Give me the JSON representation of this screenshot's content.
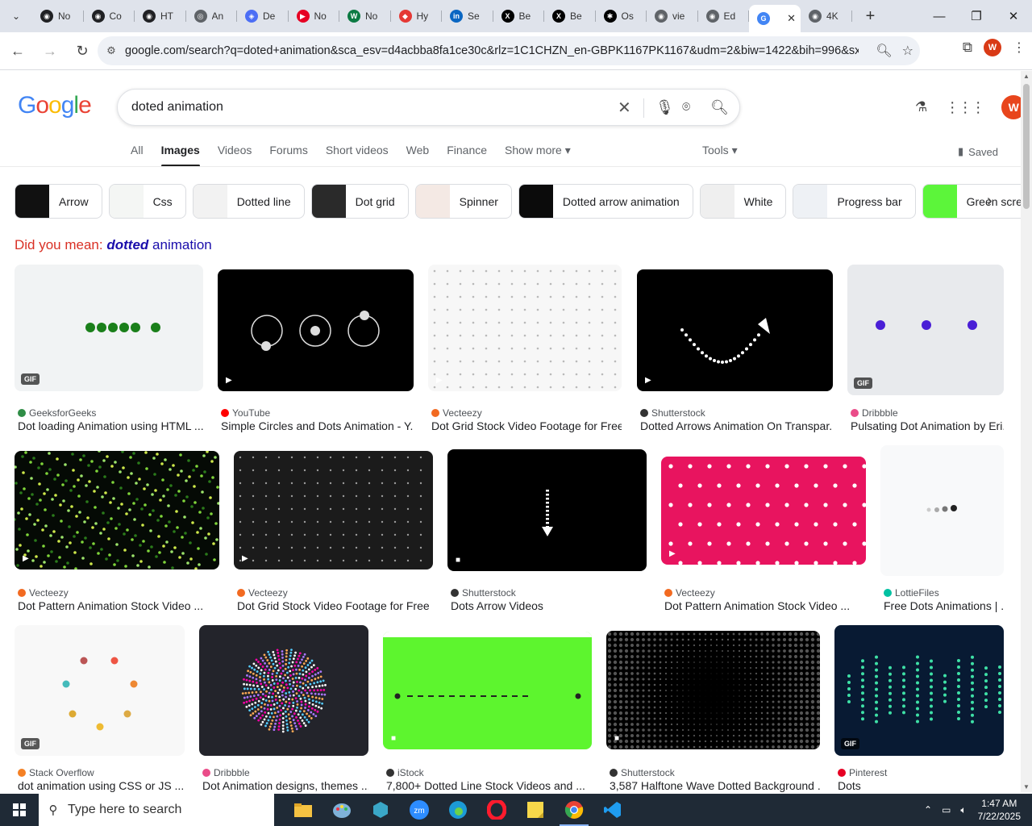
{
  "browser": {
    "tabs": [
      {
        "title": "No",
        "fav_color": "#202124",
        "fav_glyph": "◉"
      },
      {
        "title": "Co",
        "fav_color": "#202124",
        "fav_glyph": "◉"
      },
      {
        "title": "HT",
        "fav_color": "#202124",
        "fav_glyph": "◉"
      },
      {
        "title": "An",
        "fav_color": "#5f6368",
        "fav_glyph": "◎"
      },
      {
        "title": "De",
        "fav_color": "#4c6ef5",
        "fav_glyph": "◈"
      },
      {
        "title": "No",
        "fav_color": "#e60023",
        "fav_glyph": "▶"
      },
      {
        "title": "No",
        "fav_color": "#0c7a43",
        "fav_glyph": "W"
      },
      {
        "title": "Hy",
        "fav_color": "#e53935",
        "fav_glyph": "◆"
      },
      {
        "title": "Se",
        "fav_color": "#0a66c2",
        "fav_glyph": "in"
      },
      {
        "title": "Be",
        "fav_color": "#000000",
        "fav_glyph": "X"
      },
      {
        "title": "Be",
        "fav_color": "#000000",
        "fav_glyph": "X"
      },
      {
        "title": "Os",
        "fav_color": "#000000",
        "fav_glyph": "✱"
      },
      {
        "title": "vie",
        "fav_color": "#5f6368",
        "fav_glyph": "◉"
      },
      {
        "title": "Ed",
        "fav_color": "#5f6368",
        "fav_glyph": "◉"
      },
      {
        "title": "",
        "fav_color": "#4285f4",
        "fav_glyph": "G",
        "active": true
      },
      {
        "title": "4K",
        "fav_color": "#5f6368",
        "fav_glyph": "◉"
      }
    ],
    "url": "google.com/search?q=doted+animation&sca_esv=d4acbba8fa1ce30c&rlz=1C1CHZN_en-GBPK1167PK1167&udm=2&biw=1422&bih=996&sxsrf...",
    "profile_initial": "W"
  },
  "search": {
    "query": "doted animation",
    "logo": [
      "G",
      "o",
      "o",
      "g",
      "l",
      "e"
    ],
    "logo_colors": [
      "#4285f4",
      "#ea4335",
      "#fbbc05",
      "#4285f4",
      "#34a853",
      "#ea4335"
    ],
    "avatar_initial": "W"
  },
  "navtabs": [
    "All",
    "Images",
    "Videos",
    "Forums",
    "Short videos",
    "Web",
    "Finance",
    "Show more ▾"
  ],
  "active_tab": "Images",
  "tools_label": "Tools ▾",
  "saved_label": "Saved",
  "chips": [
    {
      "label": "Arrow",
      "thumb": "#111111"
    },
    {
      "label": "Css",
      "thumb": "#f4f6f4"
    },
    {
      "label": "Dotted line",
      "thumb": "#f2f2f2"
    },
    {
      "label": "Dot grid",
      "thumb": "#2a2a2a"
    },
    {
      "label": "Spinner",
      "thumb": "#f4e9e4"
    },
    {
      "label": "Dotted arrow animation",
      "thumb": "#0b0b0b"
    },
    {
      "label": "White",
      "thumb": "#efefef"
    },
    {
      "label": "Progress bar",
      "thumb": "#eef1f5"
    },
    {
      "label": "Green screen",
      "thumb": "#5cf53a"
    }
  ],
  "did_you_mean": {
    "prefix": "Did you mean:",
    "bold": "dotted",
    "rest": "animation"
  },
  "results": [
    {
      "source": "GeeksforGeeks",
      "title": "Dot loading Animation using HTML ...",
      "src_color": "#2f8d46",
      "badge": "GIF"
    },
    {
      "source": "YouTube",
      "title": "Simple Circles and Dots Animation - Y...",
      "src_color": "#ff0000",
      "badge": "▶"
    },
    {
      "source": "Vecteezy",
      "title": "Dot Grid Stock Video Footage for Free...",
      "src_color": "#f26a21",
      "badge": "▶"
    },
    {
      "source": "Shutterstock",
      "title": "Dotted Arrows Animation On Transpar...",
      "src_color": "#333333",
      "badge": "▶"
    },
    {
      "source": "Dribbble",
      "title": "Pulsating Dot Animation by Eri...",
      "src_color": "#ea4c89",
      "badge": "GIF"
    },
    {
      "source": "Vecteezy",
      "title": "Dot Pattern Animation Stock Video ...",
      "src_color": "#f26a21",
      "badge": "▶"
    },
    {
      "source": "Vecteezy",
      "title": "Dot Grid Stock Video Footage for Free ...",
      "src_color": "#f26a21",
      "badge": "▶"
    },
    {
      "source": "Shutterstock",
      "title": "Dots Arrow Videos",
      "src_color": "#333333",
      "badge": "■"
    },
    {
      "source": "Vecteezy",
      "title": "Dot Pattern Animation Stock Video ...",
      "src_color": "#f26a21",
      "badge": "▶"
    },
    {
      "source": "LottieFiles",
      "title": "Free Dots Animations | ...",
      "src_color": "#00c1a2",
      "badge": ""
    },
    {
      "source": "Stack Overflow",
      "title": "dot animation using CSS or JS ...",
      "src_color": "#f48024",
      "badge": "GIF"
    },
    {
      "source": "Dribbble",
      "title": "Dot Animation designs, themes ...",
      "src_color": "#ea4c89",
      "badge": ""
    },
    {
      "source": "iStock",
      "title": "7,800+ Dotted Line Stock Videos and ...",
      "src_color": "#333333",
      "badge": "■"
    },
    {
      "source": "Shutterstock",
      "title": "3,587 Halftone Wave Dotted Background ...",
      "src_color": "#333333",
      "badge": "■"
    },
    {
      "source": "Pinterest",
      "title": "Dots",
      "src_color": "#e60023",
      "badge": "GIF"
    }
  ],
  "taskbar": {
    "search_placeholder": "Type here to search",
    "time": "1:47 AM",
    "date": "7/22/2025"
  }
}
